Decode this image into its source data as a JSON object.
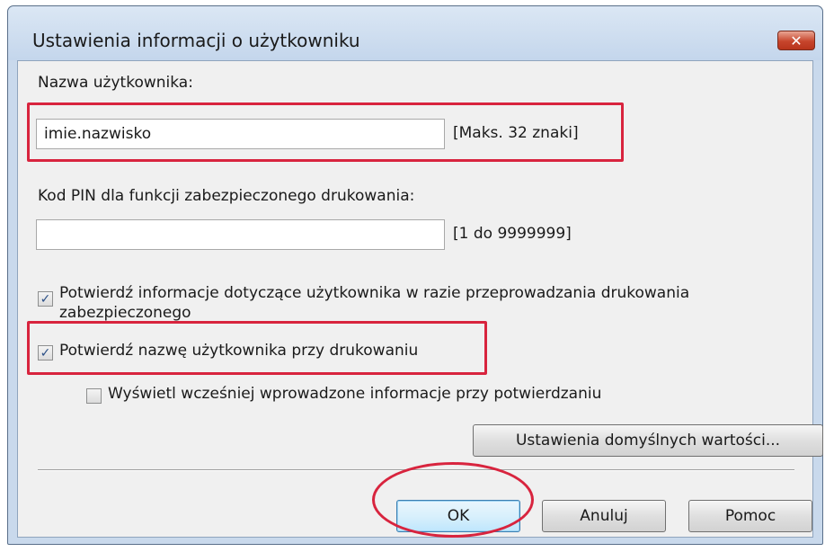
{
  "dialog": {
    "title": "Ustawienia informacji o użytkowniku",
    "close_symbol": "✕"
  },
  "username": {
    "label": "Nazwa użytkownika:",
    "value": "imie.nazwisko",
    "hint": "[Maks. 32 znaki]"
  },
  "pin": {
    "label": "Kod PIN dla funkcji zabezpieczonego drukowania:",
    "value": "",
    "hint": "[1 do 9999999]"
  },
  "options": [
    {
      "label_line1": "Potwierdź informacje dotyczące użytkownika w razie przeprowadzania drukowania",
      "label_line2": "zabezpieczonego",
      "checked": true
    },
    {
      "label": "Potwierdź nazwę użytkownika przy drukowaniu",
      "checked": true
    },
    {
      "label": "Wyświetl wcześniej wprowadzone informacje przy potwierdzaniu",
      "checked": false
    }
  ],
  "buttons": {
    "defaults": "Ustawienia domyślnych wartości...",
    "ok": "OK",
    "cancel": "Anuluj",
    "help": "Pomoc"
  },
  "colors": {
    "highlight": "#d8243e",
    "dialog_face": "#f0f0f0",
    "title_bar": "#c9d9ec"
  }
}
